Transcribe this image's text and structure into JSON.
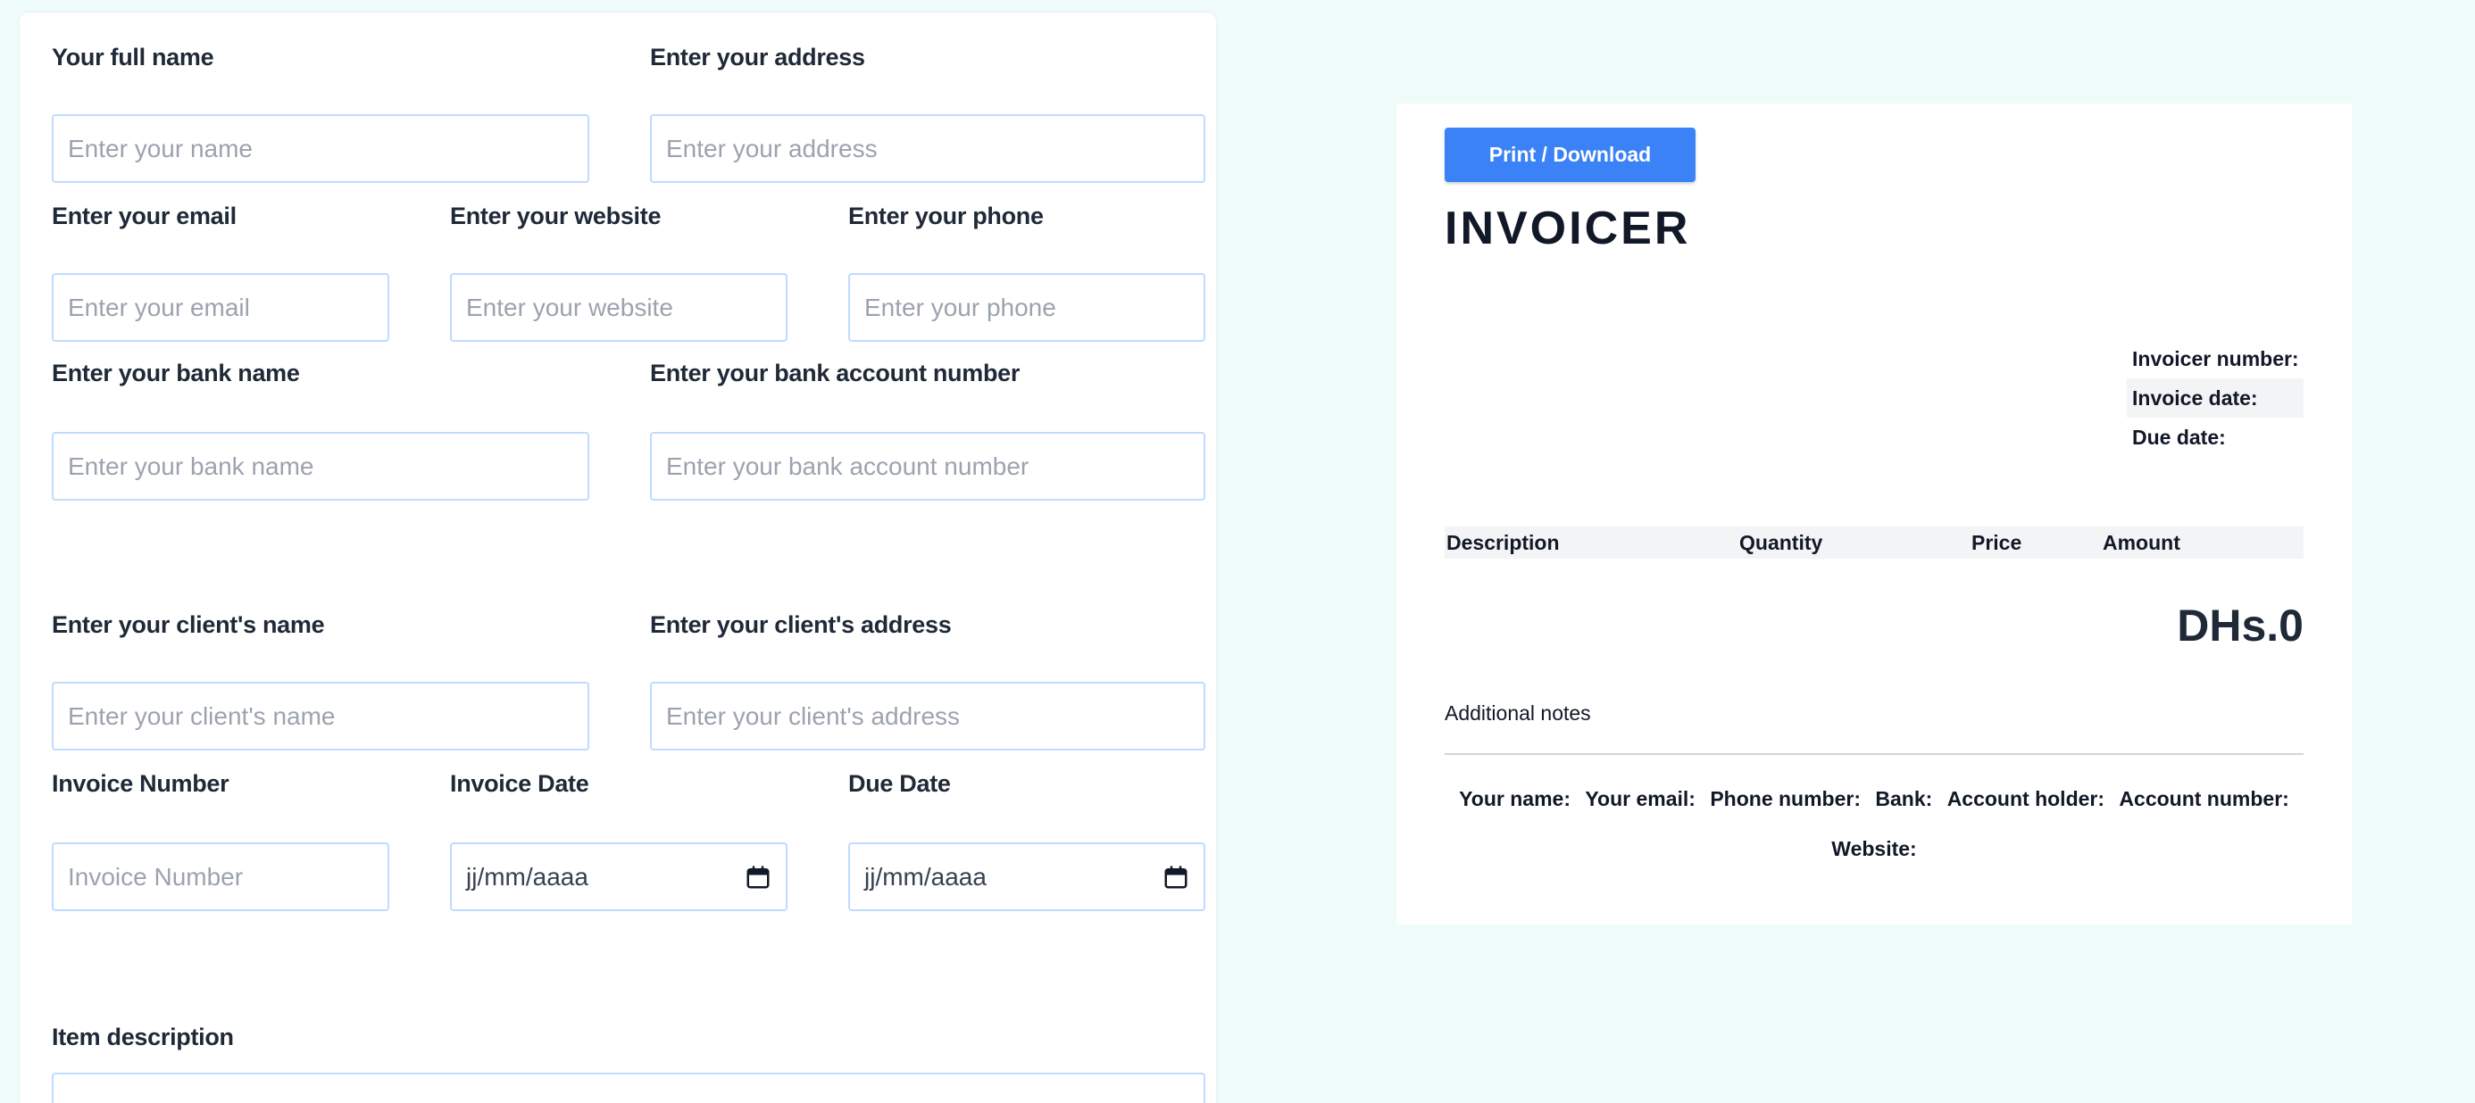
{
  "form": {
    "full_name": {
      "label": "Your full name",
      "placeholder": "Enter your name"
    },
    "address": {
      "label": "Enter your address",
      "placeholder": "Enter your address"
    },
    "email": {
      "label": "Enter your email",
      "placeholder": "Enter your email"
    },
    "website": {
      "label": "Enter your website",
      "placeholder": "Enter your website"
    },
    "phone": {
      "label": "Enter your phone",
      "placeholder": "Enter your phone"
    },
    "bank_name": {
      "label": "Enter your bank name",
      "placeholder": "Enter your bank name"
    },
    "bank_account": {
      "label": "Enter your bank account number",
      "placeholder": "Enter your bank account number"
    },
    "client_name": {
      "label": "Enter your client's name",
      "placeholder": "Enter your client's name"
    },
    "client_address": {
      "label": "Enter your client's address",
      "placeholder": "Enter your client's address"
    },
    "invoice_number": {
      "label": "Invoice Number",
      "placeholder": "Invoice Number"
    },
    "invoice_date": {
      "label": "Invoice Date",
      "value": "jj/mm/aaaa"
    },
    "due_date": {
      "label": "Due Date",
      "value": "jj/mm/aaaa"
    },
    "item_description": {
      "label": "Item description"
    }
  },
  "preview": {
    "print_button": "Print / Download",
    "title": "INVOICER",
    "invoicer_number_label": "Invoicer number:",
    "invoice_date_label": "Invoice date:",
    "due_date_label": "Due date:",
    "columns": [
      "Description",
      "Quantity",
      "Price",
      "Amount"
    ],
    "total": "DHs.0",
    "notes_label": "Additional notes",
    "footer": {
      "your_name": "Your name:",
      "your_email": "Your email:",
      "phone_number": "Phone number:",
      "bank": "Bank:",
      "account_holder": "Account holder:",
      "account_number": "Account number:",
      "website": "Website:"
    }
  },
  "icons": {
    "date_picker": "calendar-icon"
  }
}
